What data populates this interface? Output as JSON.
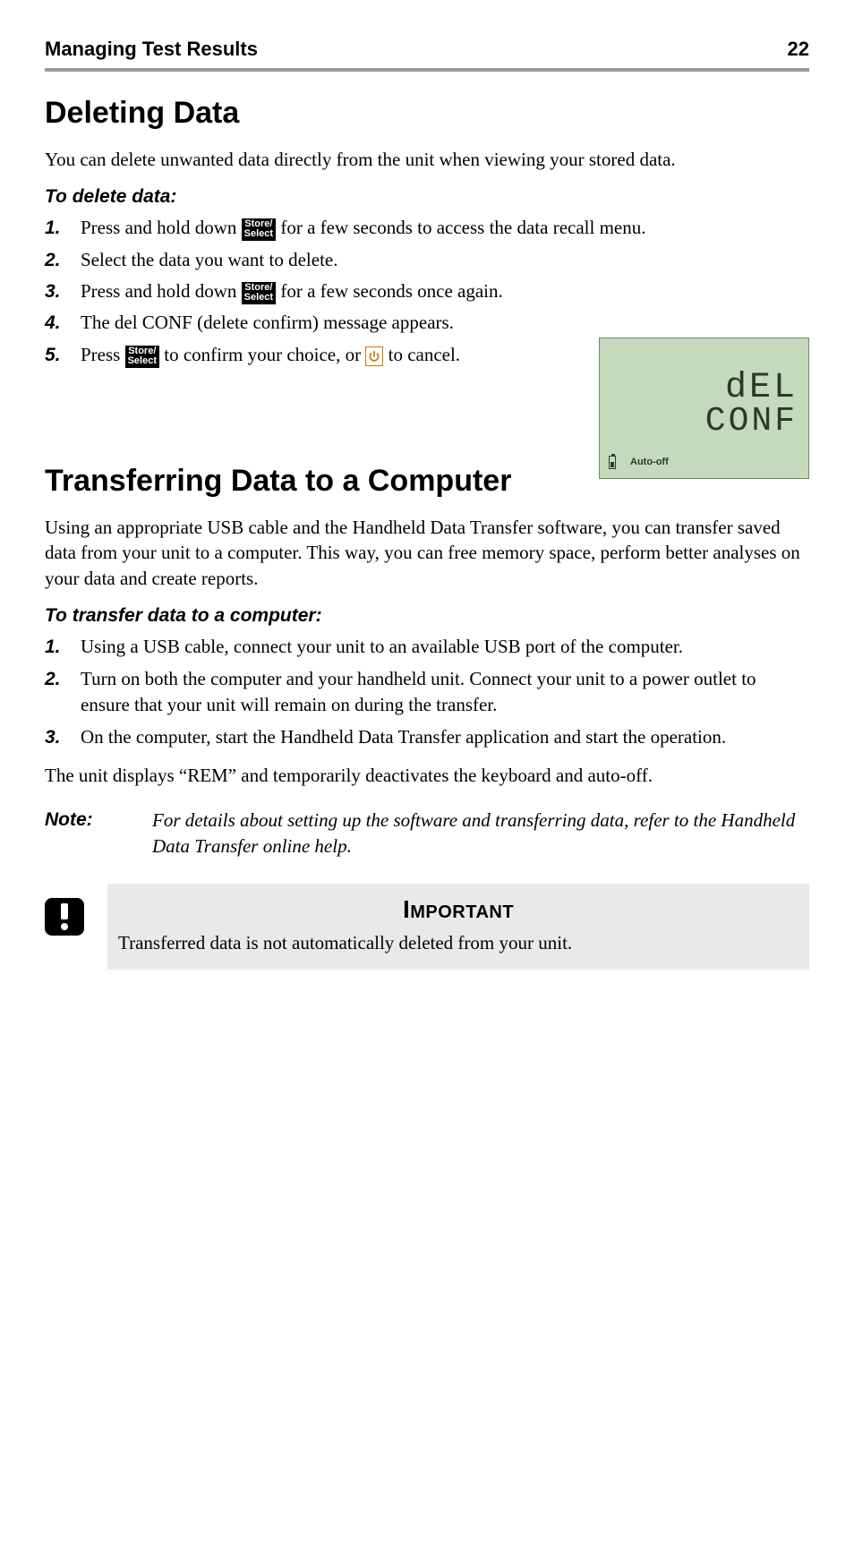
{
  "header": {
    "title": "Managing Test Results",
    "page": "22"
  },
  "section1": {
    "heading": "Deleting Data",
    "intro": "You can delete unwanted data directly from the unit when viewing your stored data.",
    "subhead": "To delete data:",
    "steps": [
      {
        "n": "1.",
        "pre": "Press and hold down ",
        "btn": true,
        "post": " for a few seconds to access the data recall menu."
      },
      {
        "n": "2.",
        "pre": "Select the data you want to delete.",
        "btn": false,
        "post": ""
      },
      {
        "n": "3.",
        "pre": "Press and hold down ",
        "btn": true,
        "post": " for a few seconds once again."
      },
      {
        "n": "4.",
        "pre": "The del CONF (delete confirm) message appears.",
        "btn": false,
        "post": ""
      }
    ],
    "step5": {
      "n": "5.",
      "t1": "Press ",
      "t2": " to confirm your choice, or ",
      "t3": " to cancel."
    }
  },
  "button": {
    "line1": "Store/",
    "line2": "Select"
  },
  "lcd": {
    "line1": "dEL",
    "line2": "CONF",
    "auto_off": "Auto-off"
  },
  "section2": {
    "heading": "Transferring Data to a Computer",
    "intro": "Using an appropriate USB cable and the Handheld Data Transfer software, you can transfer saved data from your unit to a computer. This way, you can free memory space, perform better analyses on your data and create reports.",
    "subhead": "To transfer data to a computer:",
    "steps": [
      {
        "n": "1.",
        "t": "Using a USB cable, connect your unit to an available USB port of the computer."
      },
      {
        "n": "2.",
        "t": "Turn on both the computer and your handheld unit. Connect your unit to a power outlet to ensure that your unit will remain on during the transfer."
      },
      {
        "n": "3.",
        "t": "On the computer, start the Handheld Data Transfer application and start the operation."
      }
    ],
    "closing": "The unit displays “REM” and temporarily deactivates the keyboard and auto-off."
  },
  "note": {
    "label": "Note:",
    "body": "For details about setting up the software and transferring data, refer to the Handheld Data Transfer online help."
  },
  "important": {
    "title": "Important",
    "body": "Transferred data is not automatically deleted from your unit."
  }
}
